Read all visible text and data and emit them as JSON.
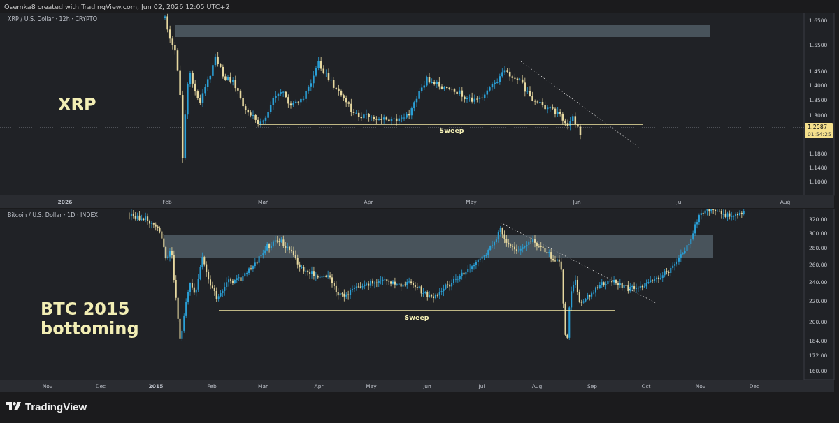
{
  "header": {
    "caption": "Osemka8 created with TradingView.com, Jun 02, 2026 12:05 UTC+2"
  },
  "panes": [
    {
      "symbol": "XRP / U.S. Dollar · 12h · CRYPTO",
      "label_lines": [
        "XRP"
      ],
      "annotation": "Sweep",
      "price_axis": [
        "1.6500",
        "1.5500",
        "1.4500",
        "1.4000",
        "1.3500",
        "1.3000",
        "1.1800",
        "1.1400",
        "1.1000"
      ],
      "last_price": "1.2587",
      "countdown": "01:54:25",
      "time_axis": [
        "2026",
        "Feb",
        "Mar",
        "Apr",
        "May",
        "Jun",
        "Jul",
        "Aug"
      ]
    },
    {
      "symbol": "Bitcoin / U.S. Dollar · 1D · INDEX",
      "label_lines": [
        "BTC 2015",
        "bottoming"
      ],
      "annotation": "Sweep",
      "price_axis": [
        "320.00",
        "300.00",
        "280.00",
        "260.00",
        "240.00",
        "220.00",
        "200.00",
        "184.00",
        "172.00",
        "160.00"
      ],
      "time_axis": [
        "Nov",
        "Dec",
        "2015",
        "Feb",
        "Mar",
        "Apr",
        "May",
        "Jun",
        "Jul",
        "Aug",
        "Sep",
        "Oct",
        "Nov",
        "Dec"
      ]
    }
  ],
  "footer": {
    "brand": "TradingView"
  }
}
